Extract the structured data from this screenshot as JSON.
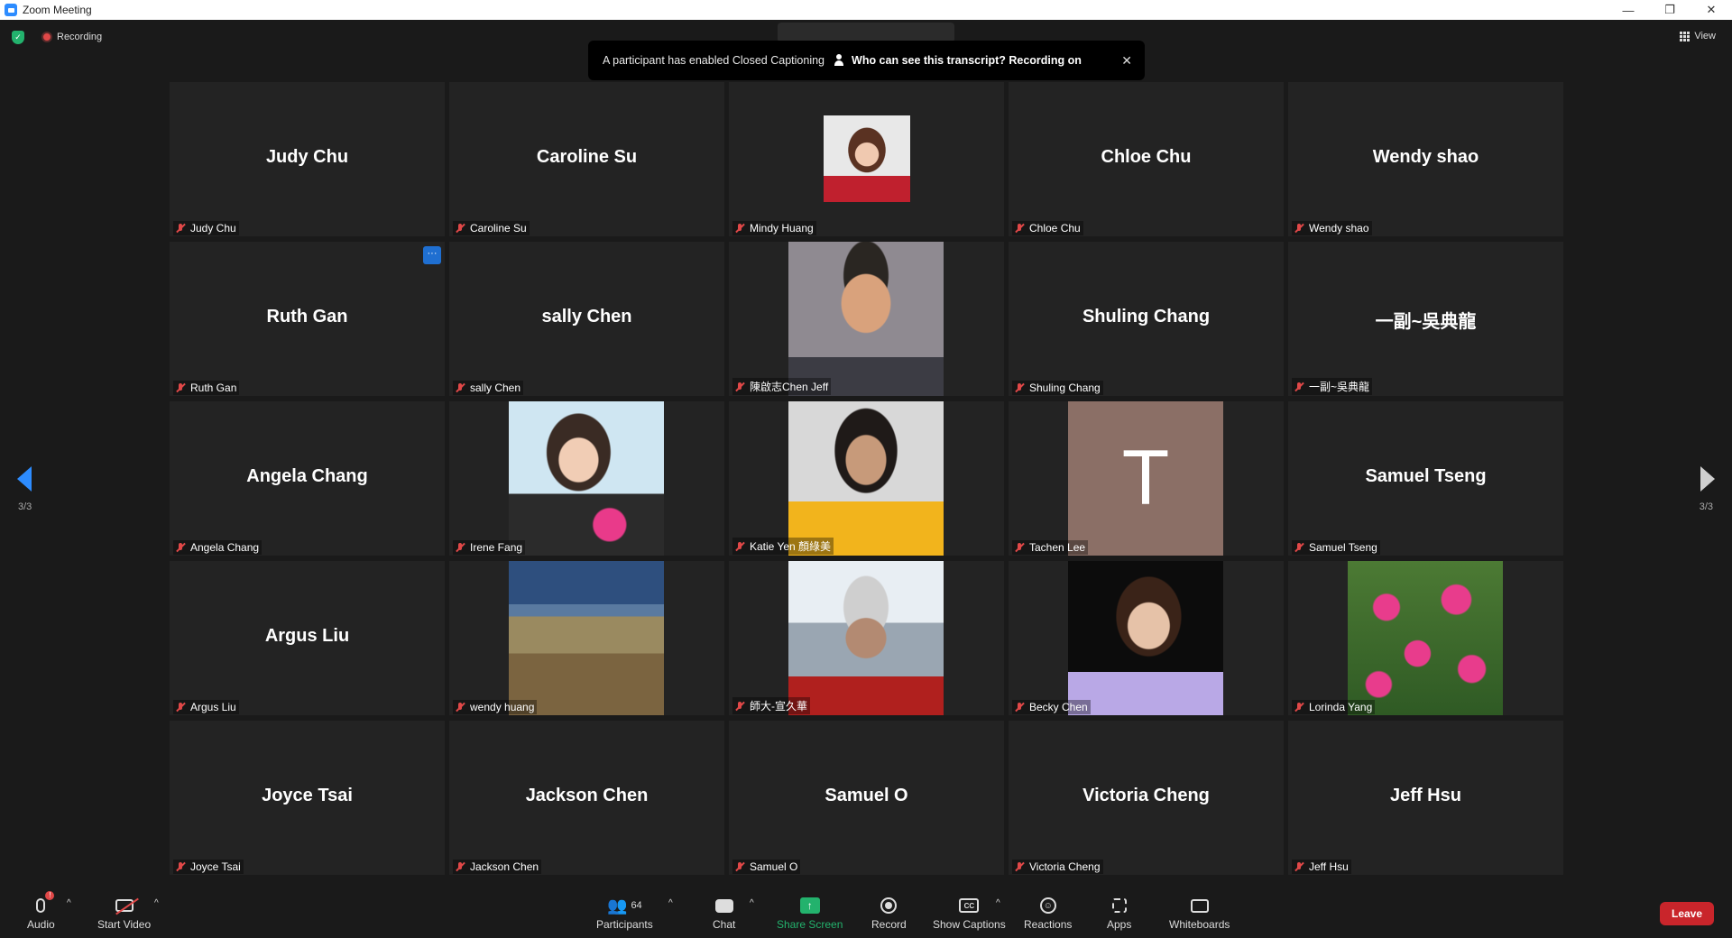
{
  "window": {
    "title": "Zoom Meeting",
    "minimize": "—",
    "restore": "❐",
    "close": "✕"
  },
  "top": {
    "recording_label": "Recording",
    "view_label": "View",
    "notification": {
      "message": "A participant has enabled Closed Captioning",
      "link": "Who can see this transcript? Recording on",
      "close": "✕"
    }
  },
  "pager": {
    "left": "3/3",
    "right": "3/3"
  },
  "tiles": [
    {
      "name": "Judy Chu",
      "label": "Judy Chu"
    },
    {
      "name": "Caroline Su",
      "label": "Caroline Su"
    },
    {
      "name": "",
      "label": "Mindy Huang"
    },
    {
      "name": "Chloe Chu",
      "label": "Chloe Chu"
    },
    {
      "name": "Wendy shao",
      "label": "Wendy shao"
    },
    {
      "name": "Ruth Gan",
      "label": "Ruth Gan",
      "more": "···"
    },
    {
      "name": "sally Chen",
      "label": "sally Chen"
    },
    {
      "name": "",
      "label": "陳啟志Chen Jeff"
    },
    {
      "name": "Shuling Chang",
      "label": "Shuling Chang"
    },
    {
      "name": "一副~吳典龍",
      "label": "一副~吳典龍"
    },
    {
      "name": "Angela Chang",
      "label": "Angela Chang"
    },
    {
      "name": "",
      "label": "Irene Fang"
    },
    {
      "name": "",
      "label": "Katie Yen 顏綠美"
    },
    {
      "name": "",
      "label": "Tachen Lee",
      "initial": "T"
    },
    {
      "name": "Samuel Tseng",
      "label": "Samuel Tseng"
    },
    {
      "name": "Argus Liu",
      "label": "Argus Liu"
    },
    {
      "name": "",
      "label": "wendy huang"
    },
    {
      "name": "",
      "label": "師大-宣久華"
    },
    {
      "name": "",
      "label": "Becky Chen"
    },
    {
      "name": "",
      "label": "Lorinda Yang"
    },
    {
      "name": "Joyce Tsai",
      "label": "Joyce Tsai"
    },
    {
      "name": "Jackson Chen",
      "label": "Jackson Chen"
    },
    {
      "name": "Samuel O",
      "label": "Samuel O"
    },
    {
      "name": "Victoria Cheng",
      "label": "Victoria Cheng"
    },
    {
      "name": "Jeff Hsu",
      "label": "Jeff Hsu"
    }
  ],
  "toolbar": {
    "audio": "Audio",
    "audio_badge": "!",
    "start_video": "Start Video",
    "participants": "Participants",
    "participants_count": "64",
    "chat": "Chat",
    "share_screen": "Share Screen",
    "record": "Record",
    "show_captions": "Show Captions",
    "captions_icon": "CC",
    "reactions": "Reactions",
    "apps": "Apps",
    "whiteboards": "Whiteboards",
    "leave": "Leave",
    "caret": "^"
  },
  "colors": {
    "accent": "#2d8cff",
    "leave": "#c9252b",
    "share": "#23b26d",
    "muted": "#e04848"
  }
}
